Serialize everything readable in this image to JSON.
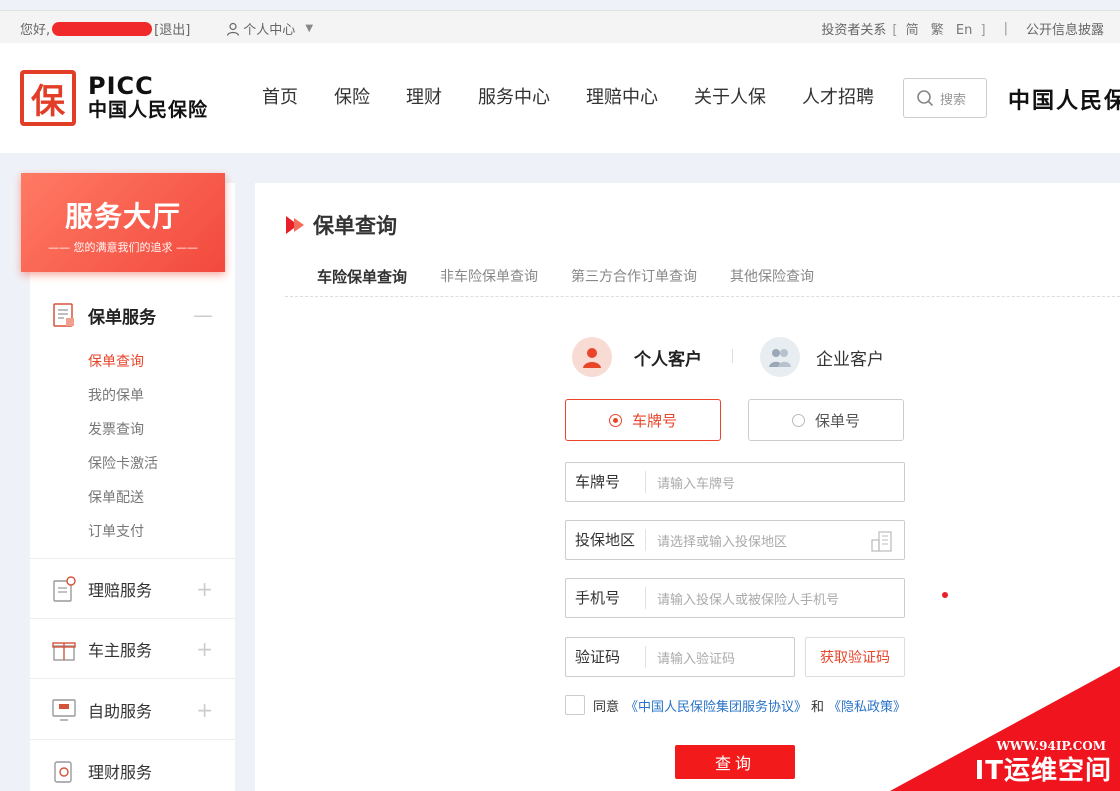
{
  "topbar": {
    "greeting": "您好,",
    "logout": "[退出]",
    "user_center": "个人中心",
    "investor": "投资者关系",
    "lang_open": "[",
    "lang_simplified": "简",
    "lang_traditional": "繁",
    "lang_en": "En",
    "lang_close": "]",
    "separator": "|",
    "disclosure": "公开信息披露"
  },
  "logo": {
    "en": "PICC",
    "cn": "中国人民保险",
    "mark": "保"
  },
  "nav": {
    "items": [
      "首页",
      "保险",
      "理财",
      "服务中心",
      "理赔中心",
      "关于人保",
      "人才招聘"
    ]
  },
  "search": {
    "placeholder": "搜索"
  },
  "brand_right": "中国人民保",
  "sidebar": {
    "hall_title": "服务大厅",
    "hall_sub": "—— 您的满意我们的追求 ——",
    "policy_service": "保单服务",
    "policy_items": [
      "保单查询",
      "我的保单",
      "发票查询",
      "保险卡激活",
      "保单配送",
      "订单支付"
    ],
    "claim_service": "理赔服务",
    "car_service": "车主服务",
    "self_service": "自助服务",
    "finance_service": "理财服务",
    "minus": "—",
    "plus": "+"
  },
  "main": {
    "title": "保单查询",
    "tabs": [
      "车险保单查询",
      "非车险保单查询",
      "第三方合作订单查询",
      "其他保险查询"
    ],
    "customer_personal": "个人客户",
    "customer_enterprise": "企业客户",
    "radio_plate": "车牌号",
    "radio_policy": "保单号",
    "fields": [
      {
        "label": "车牌号",
        "placeholder": "请输入车牌号"
      },
      {
        "label": "投保地区",
        "placeholder": "请选择或输入投保地区"
      },
      {
        "label": "手机号",
        "placeholder": "请输入投保人或被保险人手机号"
      },
      {
        "label": "验证码",
        "placeholder": "请输入验证码"
      }
    ],
    "get_code": "获取验证码",
    "agree_prefix": "同意",
    "agree_link1": "《中国人民保险集团服务协议》",
    "agree_and": "和",
    "agree_link2": "《隐私政策》",
    "query_button": "查询"
  },
  "watermark": {
    "url": "WWW.94IP.COM",
    "cn": "IT运维空间"
  },
  "colors": {
    "accent": "#e8452b",
    "button": "#f21a1a",
    "link": "#2a73c7"
  }
}
